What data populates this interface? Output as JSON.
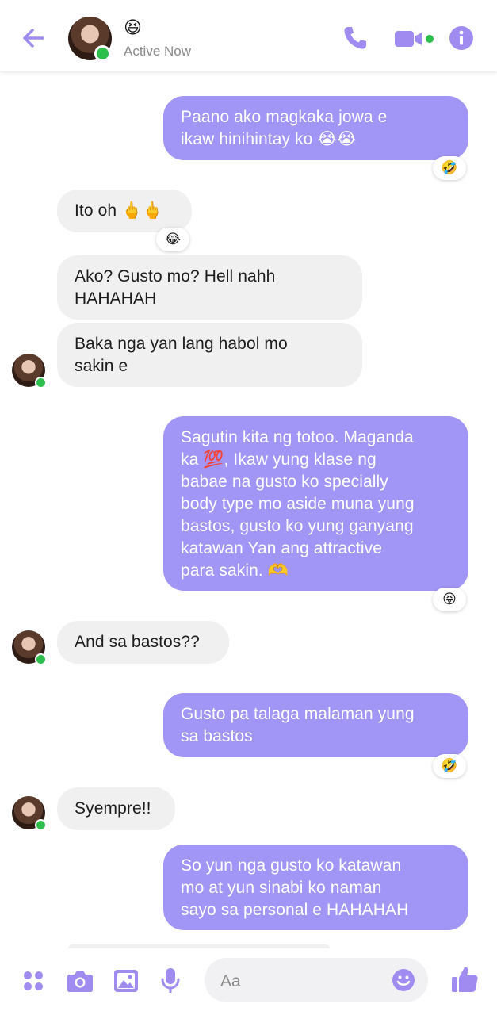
{
  "header": {
    "status_emoji": "😆",
    "status_text": "Active Now",
    "back_icon": "arrow-left-icon",
    "call_icon": "phone-icon",
    "video_icon": "video-camera-icon",
    "info_icon": "info-icon"
  },
  "colors": {
    "accent": "#a195f5",
    "icon": "#a08cf0",
    "online": "#2dbe4c",
    "incoming_bubble": "#f0f0f0"
  },
  "messages": [
    {
      "dir": "out",
      "text": "Paano ako magkaka jowa e\nikaw hinihintay ko 😭😭",
      "reaction": "🤣"
    },
    {
      "dir": "in",
      "text": "Ito oh 🖕🖕",
      "reaction": "😂"
    },
    {
      "dir": "in",
      "text": "Ako? Gusto mo? Hell nahh\nHAHAHAH"
    },
    {
      "dir": "in",
      "text": "Baka nga yan lang habol mo\nsakin e"
    },
    {
      "dir": "out",
      "text": "Sagutin kita ng totoo.  Maganda\nka 💯, Ikaw yung klase ng\nbabae na gusto ko specially\nbody type mo aside muna yung\nbastos, gusto ko yung ganyang\nkatawan Yan ang attractive\npara sakin. 🫶",
      "reaction": "😝"
    },
    {
      "dir": "in",
      "text": "And sa bastos??"
    },
    {
      "dir": "out",
      "text": "Gusto pa talaga malaman yung\nsa bastos",
      "reaction": "🤣"
    },
    {
      "dir": "in",
      "text": "Syempre!!"
    },
    {
      "dir": "out",
      "text": "So yun nga gusto ko katawan\nmo at yun sinabi ko naman\nsayo sa personal e HAHAHAH"
    }
  ],
  "composer": {
    "placeholder": "Aa",
    "icons": [
      "apps-icon",
      "camera-icon",
      "image-icon",
      "microphone-icon",
      "emoji-icon",
      "thumbs-up-icon"
    ]
  }
}
